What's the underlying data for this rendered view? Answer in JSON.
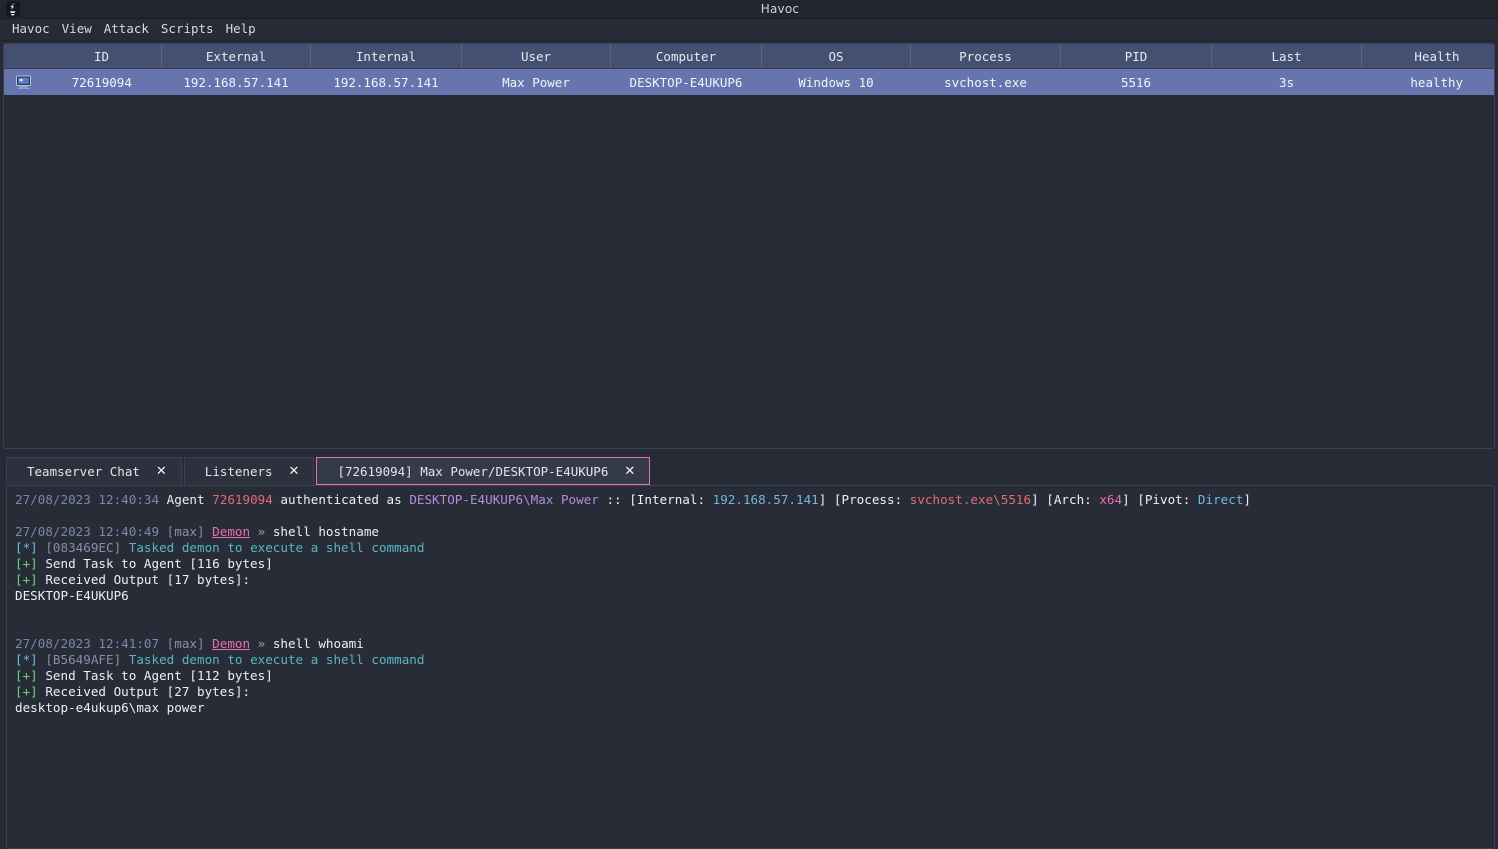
{
  "window": {
    "title": "Havoc",
    "app_icon": "havoc-logo-icon"
  },
  "menubar": {
    "items": [
      {
        "label": "Havoc",
        "name": "menu-havoc"
      },
      {
        "label": "View",
        "name": "menu-view"
      },
      {
        "label": "Attack",
        "name": "menu-attack"
      },
      {
        "label": "Scripts",
        "name": "menu-scripts"
      },
      {
        "label": "Help",
        "name": "menu-help"
      }
    ]
  },
  "sessions_table": {
    "columns": [
      "ID",
      "External",
      "Internal",
      "User",
      "Computer",
      "OS",
      "Process",
      "PID",
      "Last",
      "Health"
    ],
    "rows": [
      {
        "icon": "computer-icon",
        "id": "72619094",
        "external": "192.168.57.141",
        "internal": "192.168.57.141",
        "user": "Max Power",
        "computer": "DESKTOP-E4UKUP6",
        "os": "Windows 10",
        "process": "svchost.exe",
        "pid": "5516",
        "last": "3s",
        "health": "healthy"
      }
    ]
  },
  "tabs": [
    {
      "label": "Teamserver Chat",
      "name": "tab-teamserver-chat",
      "active": false,
      "close": "✕"
    },
    {
      "label": "Listeners",
      "name": "tab-listeners",
      "active": false,
      "close": "✕"
    },
    {
      "label": "[72619094] Max Power/DESKTOP-E4UKUP6",
      "name": "tab-demon-session",
      "active": true,
      "close": "✕"
    }
  ],
  "console": {
    "lines": [
      {
        "type": "auth",
        "segments": [
          {
            "text": "27/08/2023 12:40:34 ",
            "color": "ts"
          },
          {
            "text": "Agent ",
            "color": "white"
          },
          {
            "text": "72619094",
            "color": "red"
          },
          {
            "text": " authenticated as ",
            "color": "white"
          },
          {
            "text": "DESKTOP-E4UKUP6\\Max Power",
            "color": "purple"
          },
          {
            "text": " :: [Internal: ",
            "color": "white"
          },
          {
            "text": "192.168.57.141",
            "color": "blue"
          },
          {
            "text": "] [Process: ",
            "color": "white"
          },
          {
            "text": "svchost.exe\\5516",
            "color": "red"
          },
          {
            "text": "] [Arch: ",
            "color": "white"
          },
          {
            "text": "x64",
            "color": "magenta"
          },
          {
            "text": "] [Pivot: ",
            "color": "white"
          },
          {
            "text": "Direct",
            "color": "blue"
          },
          {
            "text": "]",
            "color": "white"
          }
        ]
      },
      {
        "type": "blank",
        "segments": []
      },
      {
        "type": "prompt",
        "segments": [
          {
            "text": "27/08/2023 12:41:07 ",
            "color": "ts"
          },
          {
            "text": "[max] ",
            "color": "grey"
          },
          {
            "text": "Demon",
            "color": "demon"
          },
          {
            "text": " » ",
            "color": "dim"
          },
          {
            "text": "shell hostname",
            "color": "white"
          }
        ]
      }
    ],
    "blocks": [
      {
        "name": "auth-block",
        "lines": [
          {
            "segments": [
              {
                "text": "27/08/2023 12:40:34 ",
                "color": "ts"
              },
              {
                "text": "Agent ",
                "color": "white"
              },
              {
                "text": "72619094",
                "color": "red"
              },
              {
                "text": " authenticated as ",
                "color": "white"
              },
              {
                "text": "DESKTOP-E4UKUP6\\Max Power",
                "color": "purple"
              },
              {
                "text": " :: [Internal: ",
                "color": "white"
              },
              {
                "text": "192.168.57.141",
                "color": "blue"
              },
              {
                "text": "] [Process: ",
                "color": "white"
              },
              {
                "text": "svchost.exe\\5516",
                "color": "red"
              },
              {
                "text": "] [Arch: ",
                "color": "white"
              },
              {
                "text": "x64",
                "color": "magenta"
              },
              {
                "text": "] [Pivot: ",
                "color": "white"
              },
              {
                "text": "Direct",
                "color": "blue"
              },
              {
                "text": "]",
                "color": "white"
              }
            ]
          },
          {
            "segments": []
          },
          {
            "segments": [
              {
                "text": "27/08/2023 12:40:49 ",
                "color": "ts"
              },
              {
                "text": "[max] ",
                "color": "grey"
              },
              {
                "text": "Demon",
                "color": "demon"
              },
              {
                "text": " » ",
                "color": "dim"
              },
              {
                "text": "shell hostname",
                "color": "white"
              }
            ]
          },
          {
            "segments": [
              {
                "text": "[*] ",
                "color": "blue"
              },
              {
                "text": "[083469EC] ",
                "color": "grey"
              },
              {
                "text": "Tasked demon to execute a shell command",
                "color": "cyan"
              }
            ]
          },
          {
            "segments": [
              {
                "text": "[+] ",
                "color": "green"
              },
              {
                "text": "Send Task to Agent [116 bytes]",
                "color": "white"
              }
            ]
          },
          {
            "segments": [
              {
                "text": "[+] ",
                "color": "green"
              },
              {
                "text": "Received Output [17 bytes]:",
                "color": "white"
              }
            ]
          },
          {
            "segments": [
              {
                "text": "DESKTOP-E4UKUP6",
                "color": "white"
              }
            ]
          },
          {
            "segments": []
          },
          {
            "segments": []
          },
          {
            "segments": [
              {
                "text": "27/08/2023 12:41:07 ",
                "color": "ts"
              },
              {
                "text": "[max] ",
                "color": "grey"
              },
              {
                "text": "Demon",
                "color": "demon"
              },
              {
                "text": " » ",
                "color": "dim"
              },
              {
                "text": "shell whoami",
                "color": "white"
              }
            ]
          },
          {
            "segments": [
              {
                "text": "[*] ",
                "color": "blue"
              },
              {
                "text": "[B5649AFE] ",
                "color": "grey"
              },
              {
                "text": "Tasked demon to execute a shell command",
                "color": "cyan"
              }
            ]
          },
          {
            "segments": [
              {
                "text": "[+] ",
                "color": "green"
              },
              {
                "text": "Send Task to Agent [112 bytes]",
                "color": "white"
              }
            ]
          },
          {
            "segments": [
              {
                "text": "[+] ",
                "color": "green"
              },
              {
                "text": "Received Output [27 bytes]:",
                "color": "white"
              }
            ]
          },
          {
            "segments": [
              {
                "text": "desktop-e4ukup6\\max power",
                "color": "white"
              }
            ]
          }
        ]
      }
    ]
  },
  "colors": {
    "window_bg": "#272b36",
    "titlebar_bg": "#22252e",
    "table_header_bg": "#454f72",
    "table_row_selected_bg": "#6675ad",
    "console_bg": "#282c37",
    "accent_pink": "#e571b0",
    "panel_border": "#3b4152"
  }
}
